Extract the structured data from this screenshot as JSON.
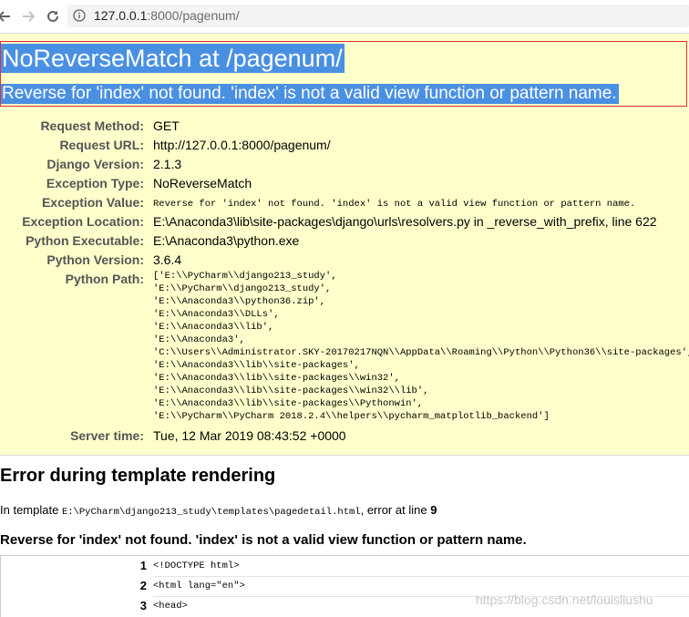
{
  "browser": {
    "url_host": "127.0.0.1",
    "url_rest": ":8000/pagenum/"
  },
  "error": {
    "title": "NoReverseMatch at /pagenum/",
    "message": "Reverse for 'index' not found. 'index' is not a valid view function or pattern name."
  },
  "meta": {
    "request_method_label": "Request Method:",
    "request_method": "GET",
    "request_url_label": "Request URL:",
    "request_url": "http://127.0.0.1:8000/pagenum/",
    "django_version_label": "Django Version:",
    "django_version": "2.1.3",
    "exception_type_label": "Exception Type:",
    "exception_type": "NoReverseMatch",
    "exception_value_label": "Exception Value:",
    "exception_value": "Reverse for 'index' not found. 'index' is not a valid view function or pattern name.",
    "exception_location_label": "Exception Location:",
    "exception_location": "E:\\Anaconda3\\lib\\site-packages\\django\\urls\\resolvers.py in _reverse_with_prefix, line 622",
    "python_executable_label": "Python Executable:",
    "python_executable": "E:\\Anaconda3\\python.exe",
    "python_version_label": "Python Version:",
    "python_version": "3.6.4",
    "python_path_label": "Python Path:",
    "python_path": [
      "['E:\\\\PyCharm\\\\django213_study',",
      " 'E:\\\\PyCharm\\\\django213_study',",
      " 'E:\\\\Anaconda3\\\\python36.zip',",
      " 'E:\\\\Anaconda3\\\\DLLs',",
      " 'E:\\\\Anaconda3\\\\lib',",
      " 'E:\\\\Anaconda3',",
      " 'C:\\\\Users\\\\Administrator.SKY-20170217NQN\\\\AppData\\\\Roaming\\\\Python\\\\Python36\\\\site-packages',",
      " 'E:\\\\Anaconda3\\\\lib\\\\site-packages',",
      " 'E:\\\\Anaconda3\\\\lib\\\\site-packages\\\\win32',",
      " 'E:\\\\Anaconda3\\\\lib\\\\site-packages\\\\win32\\\\lib',",
      " 'E:\\\\Anaconda3\\\\lib\\\\site-packages\\\\Pythonwin',",
      " 'E:\\\\PyCharm\\\\PyCharm 2018.2.4\\\\helpers\\\\pycharm_matplotlib_backend']"
    ],
    "server_time_label": "Server time:",
    "server_time": "Tue, 12 Mar 2019 08:43:52 +0000"
  },
  "template": {
    "title": "Error during template rendering",
    "in_template_prefix": "In template ",
    "template_path": "E:\\PyCharm\\django213_study\\templates\\pagedetail.html",
    "error_at_line_text": ", error at line ",
    "error_line": "9",
    "error_message": "Reverse for 'index' not found. 'index' is not a valid view function or pattern name.",
    "lines": [
      {
        "num": "1",
        "code": "<!DOCTYPE html>"
      },
      {
        "num": "2",
        "code": "<html lang=\"en\">"
      },
      {
        "num": "3",
        "code": "<head>"
      }
    ]
  },
  "watermark": "https://blog.csdn.net/louisliushu",
  "colors": {
    "summary_bg": "#ffffcc",
    "selection": "#4a90e2",
    "header_border": "#dd3333"
  }
}
